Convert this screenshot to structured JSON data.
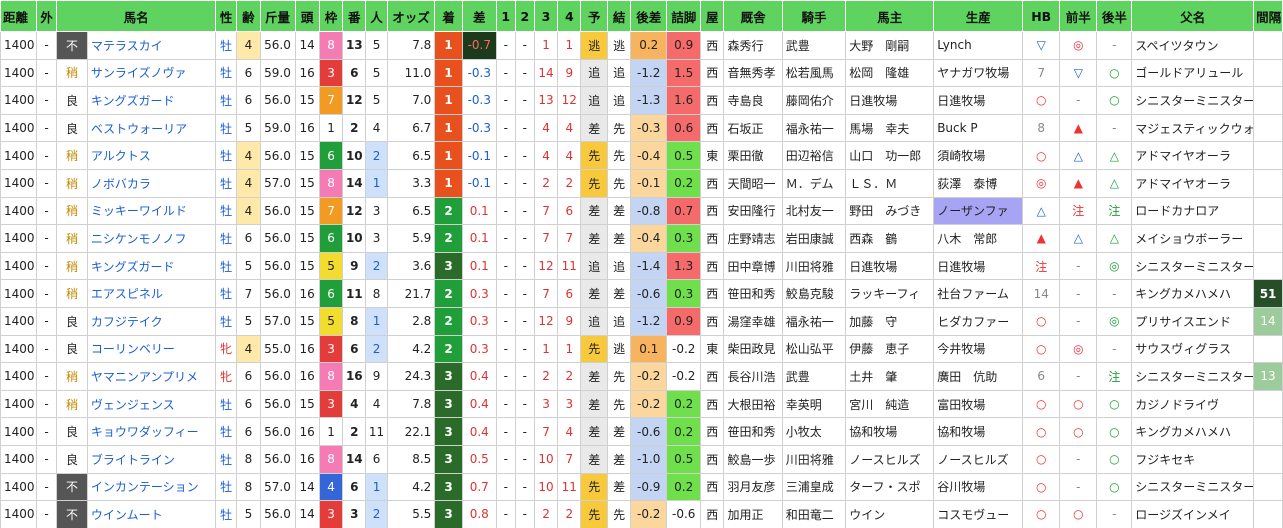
{
  "headers": [
    "距離",
    "外",
    "馬名",
    "性",
    "齢",
    "斤量",
    "頭",
    "枠",
    "番",
    "人",
    "オッズ",
    "着",
    "差",
    "1",
    "2",
    "3",
    "4",
    "予",
    "結",
    "後差",
    "詰脚",
    "屋",
    "厩舎",
    "騎手",
    "馬主",
    "生産",
    "HB",
    "前半",
    "後半",
    "父名",
    "間隔"
  ],
  "rows": [
    {
      "dist": "1400",
      "out": "-",
      "cond": "不",
      "name": "マテラスカイ",
      "sex": "牡",
      "age": "4",
      "kg": "56.0",
      "n": "14",
      "waku": "8",
      "ban": "13",
      "pop": "5",
      "odds": "7.8",
      "fin": "1",
      "diff": "-0.7",
      "p1": "-",
      "p2": "-",
      "p3": "1",
      "p4": "1",
      "yo": "逃",
      "kekka": "逃",
      "atosa": "0.2",
      "tsume": "0.9",
      "ya": "西",
      "kyu": "森秀行",
      "kishu": "武豊",
      "owner": "大野　剛嗣",
      "sei": "Lynch",
      "hb": "▽",
      "zen": "◎",
      "kou": "-",
      "father": "スペイツタウン",
      "kan": ""
    },
    {
      "dist": "1400",
      "out": "-",
      "cond": "稍",
      "name": "サンライズノヴァ",
      "sex": "牡",
      "age": "6",
      "kg": "59.0",
      "n": "16",
      "waku": "3",
      "ban": "6",
      "pop": "5",
      "odds": "11.0",
      "fin": "1",
      "diff": "-0.3",
      "p1": "-",
      "p2": "-",
      "p3": "14",
      "p4": "9",
      "yo": "追",
      "kekka": "追",
      "atosa": "-1.2",
      "tsume": "1.5",
      "ya": "西",
      "kyu": "音無秀孝",
      "kishu": "松若風馬",
      "owner": "松岡　隆雄",
      "sei": "ヤナガワ牧場",
      "hb": "7",
      "zen": "▽",
      "kou": "○",
      "father": "ゴールドアリュール",
      "kan": ""
    },
    {
      "dist": "1400",
      "out": "-",
      "cond": "良",
      "name": "キングズガード",
      "sex": "牡",
      "age": "6",
      "kg": "56.0",
      "n": "15",
      "waku": "7",
      "ban": "12",
      "pop": "5",
      "odds": "7.0",
      "fin": "1",
      "diff": "-0.3",
      "p1": "-",
      "p2": "-",
      "p3": "13",
      "p4": "12",
      "yo": "追",
      "kekka": "追",
      "atosa": "-1.3",
      "tsume": "1.6",
      "ya": "西",
      "kyu": "寺島良",
      "kishu": "藤岡佑介",
      "owner": "日進牧場",
      "sei": "日進牧場",
      "hb": "○",
      "zen": "-",
      "kou": "○",
      "father": "シニスターミニスター",
      "kan": ""
    },
    {
      "dist": "1400",
      "out": "-",
      "cond": "良",
      "name": "ベストウォーリア",
      "sex": "牡",
      "age": "5",
      "kg": "59.0",
      "n": "16",
      "waku": "1",
      "ban": "2",
      "pop": "4",
      "odds": "6.7",
      "fin": "1",
      "diff": "-0.3",
      "p1": "-",
      "p2": "-",
      "p3": "4",
      "p4": "4",
      "yo": "差",
      "kekka": "先",
      "atosa": "-0.3",
      "tsume": "0.6",
      "ya": "西",
      "kyu": "石坂正",
      "kishu": "福永祐一",
      "owner": "馬場　幸夫",
      "sei": "Buck P",
      "hb": "8",
      "zen": "▲",
      "kou": "-",
      "father": "マジェスティックウォリアー",
      "kan": ""
    },
    {
      "dist": "1400",
      "out": "-",
      "cond": "稍",
      "name": "アルクトス",
      "sex": "牡",
      "age": "4",
      "kg": "56.0",
      "n": "15",
      "waku": "6",
      "ban": "10",
      "pop": "2",
      "odds": "6.5",
      "fin": "1",
      "diff": "-0.1",
      "p1": "-",
      "p2": "-",
      "p3": "4",
      "p4": "4",
      "yo": "先",
      "kekka": "先",
      "atosa": "-0.4",
      "tsume": "0.5",
      "ya": "東",
      "kyu": "栗田徹",
      "kishu": "田辺裕信",
      "owner": "山口　功一郎",
      "sei": "須崎牧場",
      "hb": "○",
      "zen": "△",
      "kou": "△",
      "father": "アドマイヤオーラ",
      "kan": ""
    },
    {
      "dist": "1400",
      "out": "-",
      "cond": "稍",
      "name": "ノボバカラ",
      "sex": "牡",
      "age": "4",
      "kg": "57.0",
      "n": "15",
      "waku": "8",
      "ban": "14",
      "pop": "1",
      "odds": "3.3",
      "fin": "1",
      "diff": "-0.1",
      "p1": "-",
      "p2": "-",
      "p3": "2",
      "p4": "2",
      "yo": "先",
      "kekka": "先",
      "atosa": "-0.1",
      "tsume": "0.2",
      "ya": "西",
      "kyu": "天間昭一",
      "kishu": "Ｍ．デム",
      "owner": "ＬＳ．Ｍ",
      "sei": "荻澤　泰博",
      "hb": "◎",
      "zen": "▲",
      "kou": "△",
      "father": "アドマイヤオーラ",
      "kan": ""
    },
    {
      "dist": "1400",
      "out": "-",
      "cond": "稍",
      "name": "ミッキーワイルド",
      "sex": "牡",
      "age": "4",
      "kg": "56.0",
      "n": "15",
      "waku": "7",
      "ban": "12",
      "pop": "3",
      "odds": "6.5",
      "fin": "2",
      "diff": "0.1",
      "p1": "-",
      "p2": "-",
      "p3": "7",
      "p4": "6",
      "yo": "差",
      "kekka": "差",
      "atosa": "-0.8",
      "tsume": "0.7",
      "ya": "西",
      "kyu": "安田隆行",
      "kishu": "北村友一",
      "owner": "野田　みづき",
      "sei": "ノーザンファ",
      "hb": "△",
      "zen": "注",
      "kou": "注",
      "father": "ロードカナロア",
      "kan": ""
    },
    {
      "dist": "1400",
      "out": "-",
      "cond": "稍",
      "name": "ニシケンモノノフ",
      "sex": "牡",
      "age": "6",
      "kg": "56.0",
      "n": "15",
      "waku": "6",
      "ban": "10",
      "pop": "3",
      "odds": "5.9",
      "fin": "2",
      "diff": "0.1",
      "p1": "-",
      "p2": "-",
      "p3": "7",
      "p4": "7",
      "yo": "差",
      "kekka": "差",
      "atosa": "-0.4",
      "tsume": "0.3",
      "ya": "西",
      "kyu": "庄野靖志",
      "kishu": "岩田康誠",
      "owner": "西森　鶴",
      "sei": "八木　常郎",
      "hb": "▲",
      "zen": "△",
      "kou": "△",
      "father": "メイショウボーラー",
      "kan": ""
    },
    {
      "dist": "1400",
      "out": "-",
      "cond": "稍",
      "name": "キングズガード",
      "sex": "牡",
      "age": "5",
      "kg": "56.0",
      "n": "15",
      "waku": "5",
      "ban": "9",
      "pop": "2",
      "odds": "3.6",
      "fin": "3",
      "diff": "0.1",
      "p1": "-",
      "p2": "-",
      "p3": "12",
      "p4": "11",
      "yo": "追",
      "kekka": "追",
      "atosa": "-1.4",
      "tsume": "1.3",
      "ya": "西",
      "kyu": "田中章博",
      "kishu": "川田将雅",
      "owner": "日進牧場",
      "sei": "日進牧場",
      "hb": "注",
      "zen": "-",
      "kou": "◎",
      "father": "シニスターミニスター",
      "kan": ""
    },
    {
      "dist": "1400",
      "out": "-",
      "cond": "稍",
      "name": "エアスピネル",
      "sex": "牡",
      "age": "7",
      "kg": "56.0",
      "n": "16",
      "waku": "6",
      "ban": "11",
      "pop": "8",
      "odds": "21.7",
      "fin": "2",
      "diff": "0.3",
      "p1": "-",
      "p2": "-",
      "p3": "7",
      "p4": "6",
      "yo": "差",
      "kekka": "差",
      "atosa": "-0.6",
      "tsume": "0.3",
      "ya": "西",
      "kyu": "笹田和秀",
      "kishu": "鮫島克駿",
      "owner": "ラッキーフィ",
      "sei": "社台ファーム",
      "hb": "14",
      "zen": "-",
      "kou": "-",
      "father": "キングカメハメハ",
      "kan": "51"
    },
    {
      "dist": "1400",
      "out": "-",
      "cond": "良",
      "name": "カフジテイク",
      "sex": "牡",
      "age": "5",
      "kg": "57.0",
      "n": "15",
      "waku": "5",
      "ban": "8",
      "pop": "1",
      "odds": "2.8",
      "fin": "2",
      "diff": "0.3",
      "p1": "-",
      "p2": "-",
      "p3": "12",
      "p4": "9",
      "yo": "追",
      "kekka": "追",
      "atosa": "-1.2",
      "tsume": "0.9",
      "ya": "西",
      "kyu": "湯窪幸雄",
      "kishu": "福永祐一",
      "owner": "加藤　守",
      "sei": "ヒダカファー",
      "hb": "○",
      "zen": "-",
      "kou": "◎",
      "father": "プリサイスエンド",
      "kan": "14"
    },
    {
      "dist": "1400",
      "out": "-",
      "cond": "良",
      "name": "コーリンベリー",
      "sex": "牝",
      "age": "4",
      "kg": "55.0",
      "n": "16",
      "waku": "3",
      "ban": "6",
      "pop": "2",
      "odds": "4.2",
      "fin": "2",
      "diff": "0.3",
      "p1": "-",
      "p2": "-",
      "p3": "1",
      "p4": "1",
      "yo": "先",
      "kekka": "逃",
      "atosa": "0.1",
      "tsume": "-0.2",
      "ya": "東",
      "kyu": "柴田政見",
      "kishu": "松山弘平",
      "owner": "伊藤　恵子",
      "sei": "今井牧場",
      "hb": "○",
      "zen": "◎",
      "kou": "-",
      "father": "サウスヴィグラス",
      "kan": ""
    },
    {
      "dist": "1400",
      "out": "-",
      "cond": "稍",
      "name": "ヤマニンアンプリメ",
      "sex": "牝",
      "age": "6",
      "kg": "56.0",
      "n": "16",
      "waku": "8",
      "ban": "16",
      "pop": "9",
      "odds": "24.3",
      "fin": "3",
      "diff": "0.4",
      "p1": "-",
      "p2": "-",
      "p3": "2",
      "p4": "2",
      "yo": "差",
      "kekka": "先",
      "atosa": "-0.2",
      "tsume": "-0.2",
      "ya": "西",
      "kyu": "長谷川浩",
      "kishu": "武豊",
      "owner": "土井　肇",
      "sei": "廣田　伉助",
      "hb": "6",
      "zen": "-",
      "kou": "注",
      "father": "シニスターミニスター",
      "kan": "13"
    },
    {
      "dist": "1400",
      "out": "-",
      "cond": "稍",
      "name": "ヴェンジェンス",
      "sex": "牡",
      "age": "6",
      "kg": "56.0",
      "n": "15",
      "waku": "3",
      "ban": "4",
      "pop": "4",
      "odds": "7.8",
      "fin": "3",
      "diff": "0.4",
      "p1": "-",
      "p2": "-",
      "p3": "3",
      "p4": "3",
      "yo": "差",
      "kekka": "先",
      "atosa": "-0.2",
      "tsume": "0.2",
      "ya": "西",
      "kyu": "大根田裕",
      "kishu": "幸英明",
      "owner": "宮川　純造",
      "sei": "富田牧場",
      "hb": "○",
      "zen": "○",
      "kou": "○",
      "father": "カジノドライヴ",
      "kan": ""
    },
    {
      "dist": "1400",
      "out": "-",
      "cond": "良",
      "name": "キョウワダッフィー",
      "sex": "牡",
      "age": "6",
      "kg": "56.0",
      "n": "16",
      "waku": "1",
      "ban": "2",
      "pop": "11",
      "odds": "22.1",
      "fin": "3",
      "diff": "0.4",
      "p1": "-",
      "p2": "-",
      "p3": "7",
      "p4": "4",
      "yo": "差",
      "kekka": "差",
      "atosa": "-0.6",
      "tsume": "0.2",
      "ya": "西",
      "kyu": "笹田和秀",
      "kishu": "小牧太",
      "owner": "協和牧場",
      "sei": "協和牧場",
      "hb": "○",
      "zen": "○",
      "kou": "○",
      "father": "キングカメハメハ",
      "kan": ""
    },
    {
      "dist": "1400",
      "out": "-",
      "cond": "良",
      "name": "ブライトライン",
      "sex": "牡",
      "age": "8",
      "kg": "56.0",
      "n": "16",
      "waku": "8",
      "ban": "14",
      "pop": "6",
      "odds": "8.5",
      "fin": "3",
      "diff": "0.5",
      "p1": "-",
      "p2": "-",
      "p3": "10",
      "p4": "7",
      "yo": "差",
      "kekka": "差",
      "atosa": "-1.0",
      "tsume": "0.5",
      "ya": "西",
      "kyu": "鮫島一歩",
      "kishu": "川田将雅",
      "owner": "ノースヒルズ",
      "sei": "ノースヒルズ",
      "hb": "○",
      "zen": "-",
      "kou": "○",
      "father": "フジキセキ",
      "kan": ""
    },
    {
      "dist": "1400",
      "out": "-",
      "cond": "不",
      "name": "インカンテーション",
      "sex": "牡",
      "age": "8",
      "kg": "57.0",
      "n": "14",
      "waku": "4",
      "ban": "6",
      "pop": "1",
      "odds": "4.2",
      "fin": "3",
      "diff": "0.7",
      "p1": "-",
      "p2": "-",
      "p3": "10",
      "p4": "11",
      "yo": "先",
      "kekka": "差",
      "atosa": "-0.9",
      "tsume": "0.2",
      "ya": "西",
      "kyu": "羽月友彦",
      "kishu": "三浦皇成",
      "owner": "ターフ・スポ",
      "sei": "谷川牧場",
      "hb": "○",
      "zen": "-",
      "kou": "○",
      "father": "シニスターミニスター",
      "kan": ""
    },
    {
      "dist": "1400",
      "out": "-",
      "cond": "不",
      "name": "ウインムート",
      "sex": "牡",
      "age": "5",
      "kg": "56.0",
      "n": "14",
      "waku": "3",
      "ban": "3",
      "pop": "2",
      "odds": "5.5",
      "fin": "3",
      "diff": "0.8",
      "p1": "-",
      "p2": "-",
      "p3": "2",
      "p4": "2",
      "yo": "先",
      "kekka": "先",
      "atosa": "-0.2",
      "tsume": "-0.6",
      "ya": "西",
      "kyu": "加用正",
      "kishu": "和田竜二",
      "owner": "ウイン",
      "sei": "コスモヴュー",
      "hb": "○",
      "zen": "○",
      "kou": "-",
      "father": "ロージズインメイ",
      "kan": ""
    }
  ]
}
